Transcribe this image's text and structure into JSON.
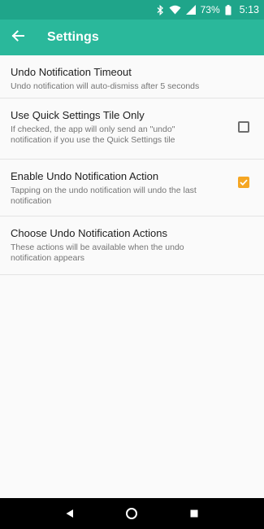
{
  "status_bar": {
    "battery_percent": "73%",
    "time": "5:13",
    "icons": [
      "bluetooth-icon",
      "wifi-icon",
      "signal-icon",
      "battery-icon"
    ]
  },
  "app_bar": {
    "title": "Settings",
    "back_icon": "arrow-left-icon"
  },
  "preferences": [
    {
      "title": "Undo Notification Timeout",
      "summary": "Undo notification will auto-dismiss after 5 seconds"
    },
    {
      "title": "Use Quick Settings Tile Only",
      "summary": "If checked, the app will only send an \"undo\" notification if you use the Quick Settings tile",
      "checked": false
    },
    {
      "title": "Enable Undo Notification Action",
      "summary": "Tapping on the undo notification will undo the last notification",
      "checked": true
    },
    {
      "title": "Choose Undo Notification Actions",
      "summary": "These actions will be available when the undo notification appears"
    }
  ],
  "nav_bar": {
    "icons": [
      "back-triangle-icon",
      "home-circle-icon",
      "recents-square-icon"
    ]
  },
  "colors": {
    "status_bar": "#1fa58a",
    "app_bar": "#2ab89b",
    "checkbox_accent": "#f5a623"
  }
}
